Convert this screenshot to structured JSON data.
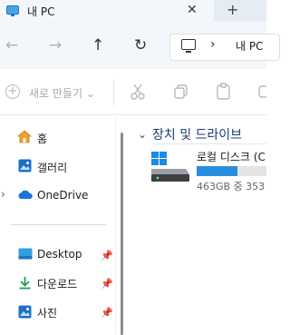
{
  "tab": {
    "title": "내 PC",
    "close": "✕",
    "new_tab": "+"
  },
  "nav": {
    "back": "←",
    "forward": "→",
    "up": "↑",
    "refresh": "↻"
  },
  "address": {
    "separator": "›",
    "location": "내 PC"
  },
  "command_bar": {
    "new_label": "새로 만들기 ⌄"
  },
  "sidebar": {
    "top": [
      {
        "label": "홈",
        "icon": "home-icon"
      },
      {
        "label": "갤러리",
        "icon": "gallery-icon"
      },
      {
        "label": "OneDrive",
        "icon": "cloud-icon"
      }
    ],
    "pinned": [
      {
        "label": "Desktop",
        "icon": "desktop-folder-icon"
      },
      {
        "label": "다운로드",
        "icon": "download-icon"
      },
      {
        "label": "사진",
        "icon": "pictures-icon"
      }
    ],
    "expand_chevron": "›",
    "pin_glyph": "📌"
  },
  "content": {
    "group_title": "장치 및 드라이브",
    "group_chevron": "⌄",
    "drive": {
      "name": "로컬 디스크 (C",
      "free_text": "463GB 중 353",
      "used_fraction": 0.58
    }
  },
  "colors": {
    "accent": "#2a8ee0",
    "tab_bg": "#f3f6fb"
  }
}
